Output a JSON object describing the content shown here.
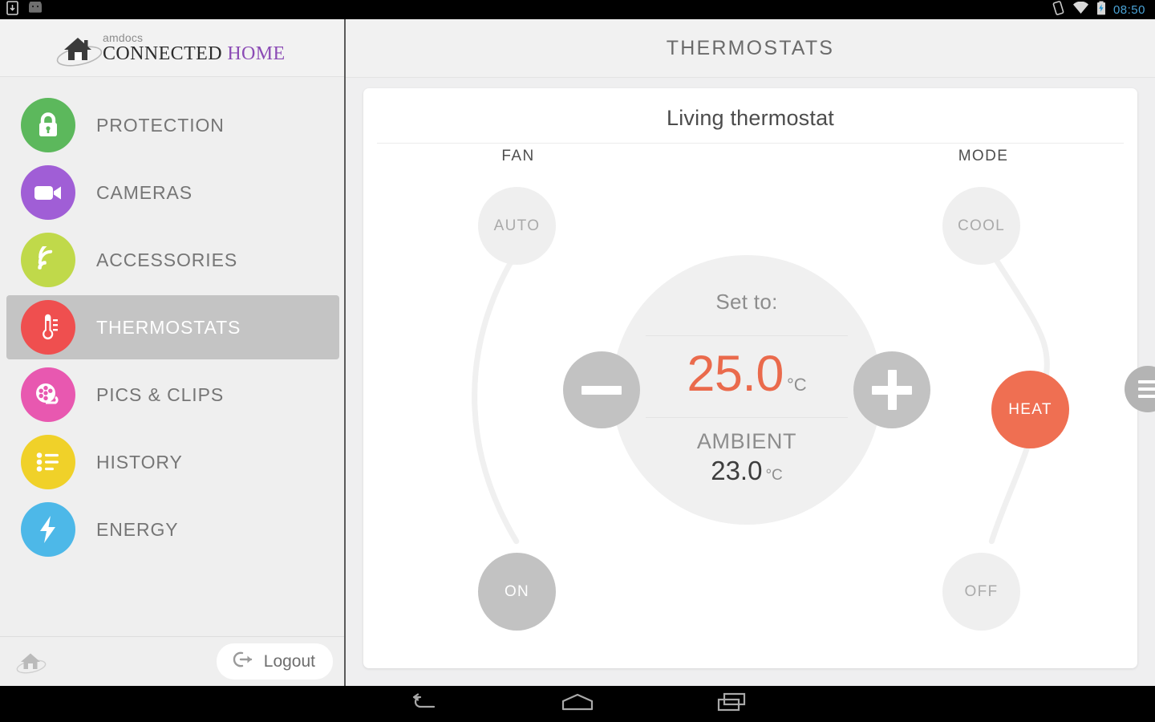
{
  "status_bar": {
    "time": "08:50",
    "icons": [
      "vibrate-icon",
      "wifi-icon",
      "battery-charging-icon"
    ],
    "clock_color": "#4aa3d6"
  },
  "sidebar": {
    "brand": {
      "logo_icon": "amdocs-house-logo",
      "sub": "amdocs",
      "main_first": "CONNECTED ",
      "main_second": "HOME",
      "accent_color": "#8b4bb5"
    },
    "items": [
      {
        "label": "PROTECTION",
        "icon": "lock-icon",
        "color": "#5cb85c",
        "active": false
      },
      {
        "label": "CAMERAS",
        "icon": "video-camera-icon",
        "color": "#a05ed6",
        "active": false
      },
      {
        "label": "ACCESSORIES",
        "icon": "signal-wave-icon",
        "color": "#c0d94a",
        "active": false
      },
      {
        "label": "THERMOSTATS",
        "icon": "thermometer-icon",
        "color": "#ef4f4f",
        "active": true
      },
      {
        "label": "PICS & CLIPS",
        "icon": "film-reel-icon",
        "color": "#e858b0",
        "active": false
      },
      {
        "label": "HISTORY",
        "icon": "list-icon",
        "color": "#f0d129",
        "active": false
      },
      {
        "label": "ENERGY",
        "icon": "lightning-icon",
        "color": "#4db8e8",
        "active": false
      }
    ],
    "footer": {
      "home_icon": "home-orbit-icon",
      "logout_icon": "logout-arrow-icon",
      "logout_label": "Logout"
    }
  },
  "header": {
    "title": "THERMOSTATS"
  },
  "thermostat": {
    "name": "Living thermostat",
    "fan": {
      "label": "FAN",
      "options": [
        {
          "label": "AUTO",
          "selected": false
        },
        {
          "label": "ON",
          "selected": true
        }
      ]
    },
    "mode": {
      "label": "MODE",
      "options": [
        {
          "label": "COOL",
          "selected": false
        },
        {
          "label": "HEAT",
          "selected": true
        },
        {
          "label": "OFF",
          "selected": false
        }
      ],
      "selected_color": "#ef6f52"
    },
    "setpoint": {
      "caption": "Set to:",
      "value": "25.0",
      "unit": "°C",
      "value_color": "#ea6a4c"
    },
    "ambient": {
      "label": "AMBIENT",
      "value": "23.0",
      "unit": "°C"
    },
    "decrease_icon": "minus-icon",
    "increase_icon": "plus-icon"
  },
  "drawer": {
    "handle_icon": "hamburger-icon"
  },
  "nav_bar": {
    "buttons": [
      {
        "icon": "back-icon"
      },
      {
        "icon": "home-icon"
      },
      {
        "icon": "recents-icon"
      }
    ]
  }
}
